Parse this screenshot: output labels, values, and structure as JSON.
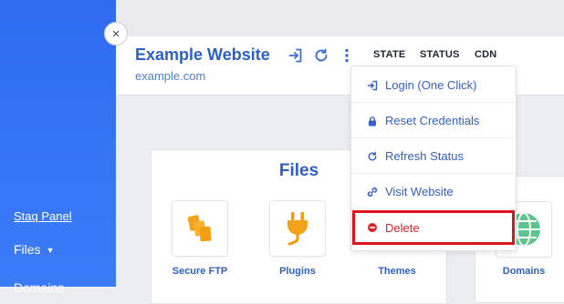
{
  "sidebar": {
    "links": {
      "staq_panel": "Staq Panel",
      "files": "Files",
      "domains": "Domains"
    }
  },
  "header": {
    "site_title": "Example Website",
    "site_url": "example.com",
    "columns": {
      "state": "STATE",
      "status": "STATUS",
      "cdn": "CDN"
    }
  },
  "menu": {
    "items": [
      {
        "label": "Login (One Click)",
        "icon": "login-icon"
      },
      {
        "label": "Reset Credentials",
        "icon": "lock-icon"
      },
      {
        "label": "Refresh Status",
        "icon": "refresh-icon"
      },
      {
        "label": "Visit Website",
        "icon": "link-icon"
      },
      {
        "label": "Delete",
        "icon": "delete-icon",
        "color": "#d8262c"
      }
    ]
  },
  "files_panel": {
    "title": "Files",
    "tiles": [
      {
        "label": "Secure FTP",
        "icon": "folders-icon"
      },
      {
        "label": "Plugins",
        "icon": "plug-icon"
      },
      {
        "label": "Themes",
        "icon": "themes-icon"
      }
    ]
  },
  "domains_panel": {
    "tile": {
      "label": "Domains",
      "icon": "globe-icon"
    }
  },
  "colors": {
    "sidebar": "#2f6cf0",
    "accent": "#2d5fc9",
    "danger": "#d8262c",
    "highlight": "#e0111b"
  }
}
